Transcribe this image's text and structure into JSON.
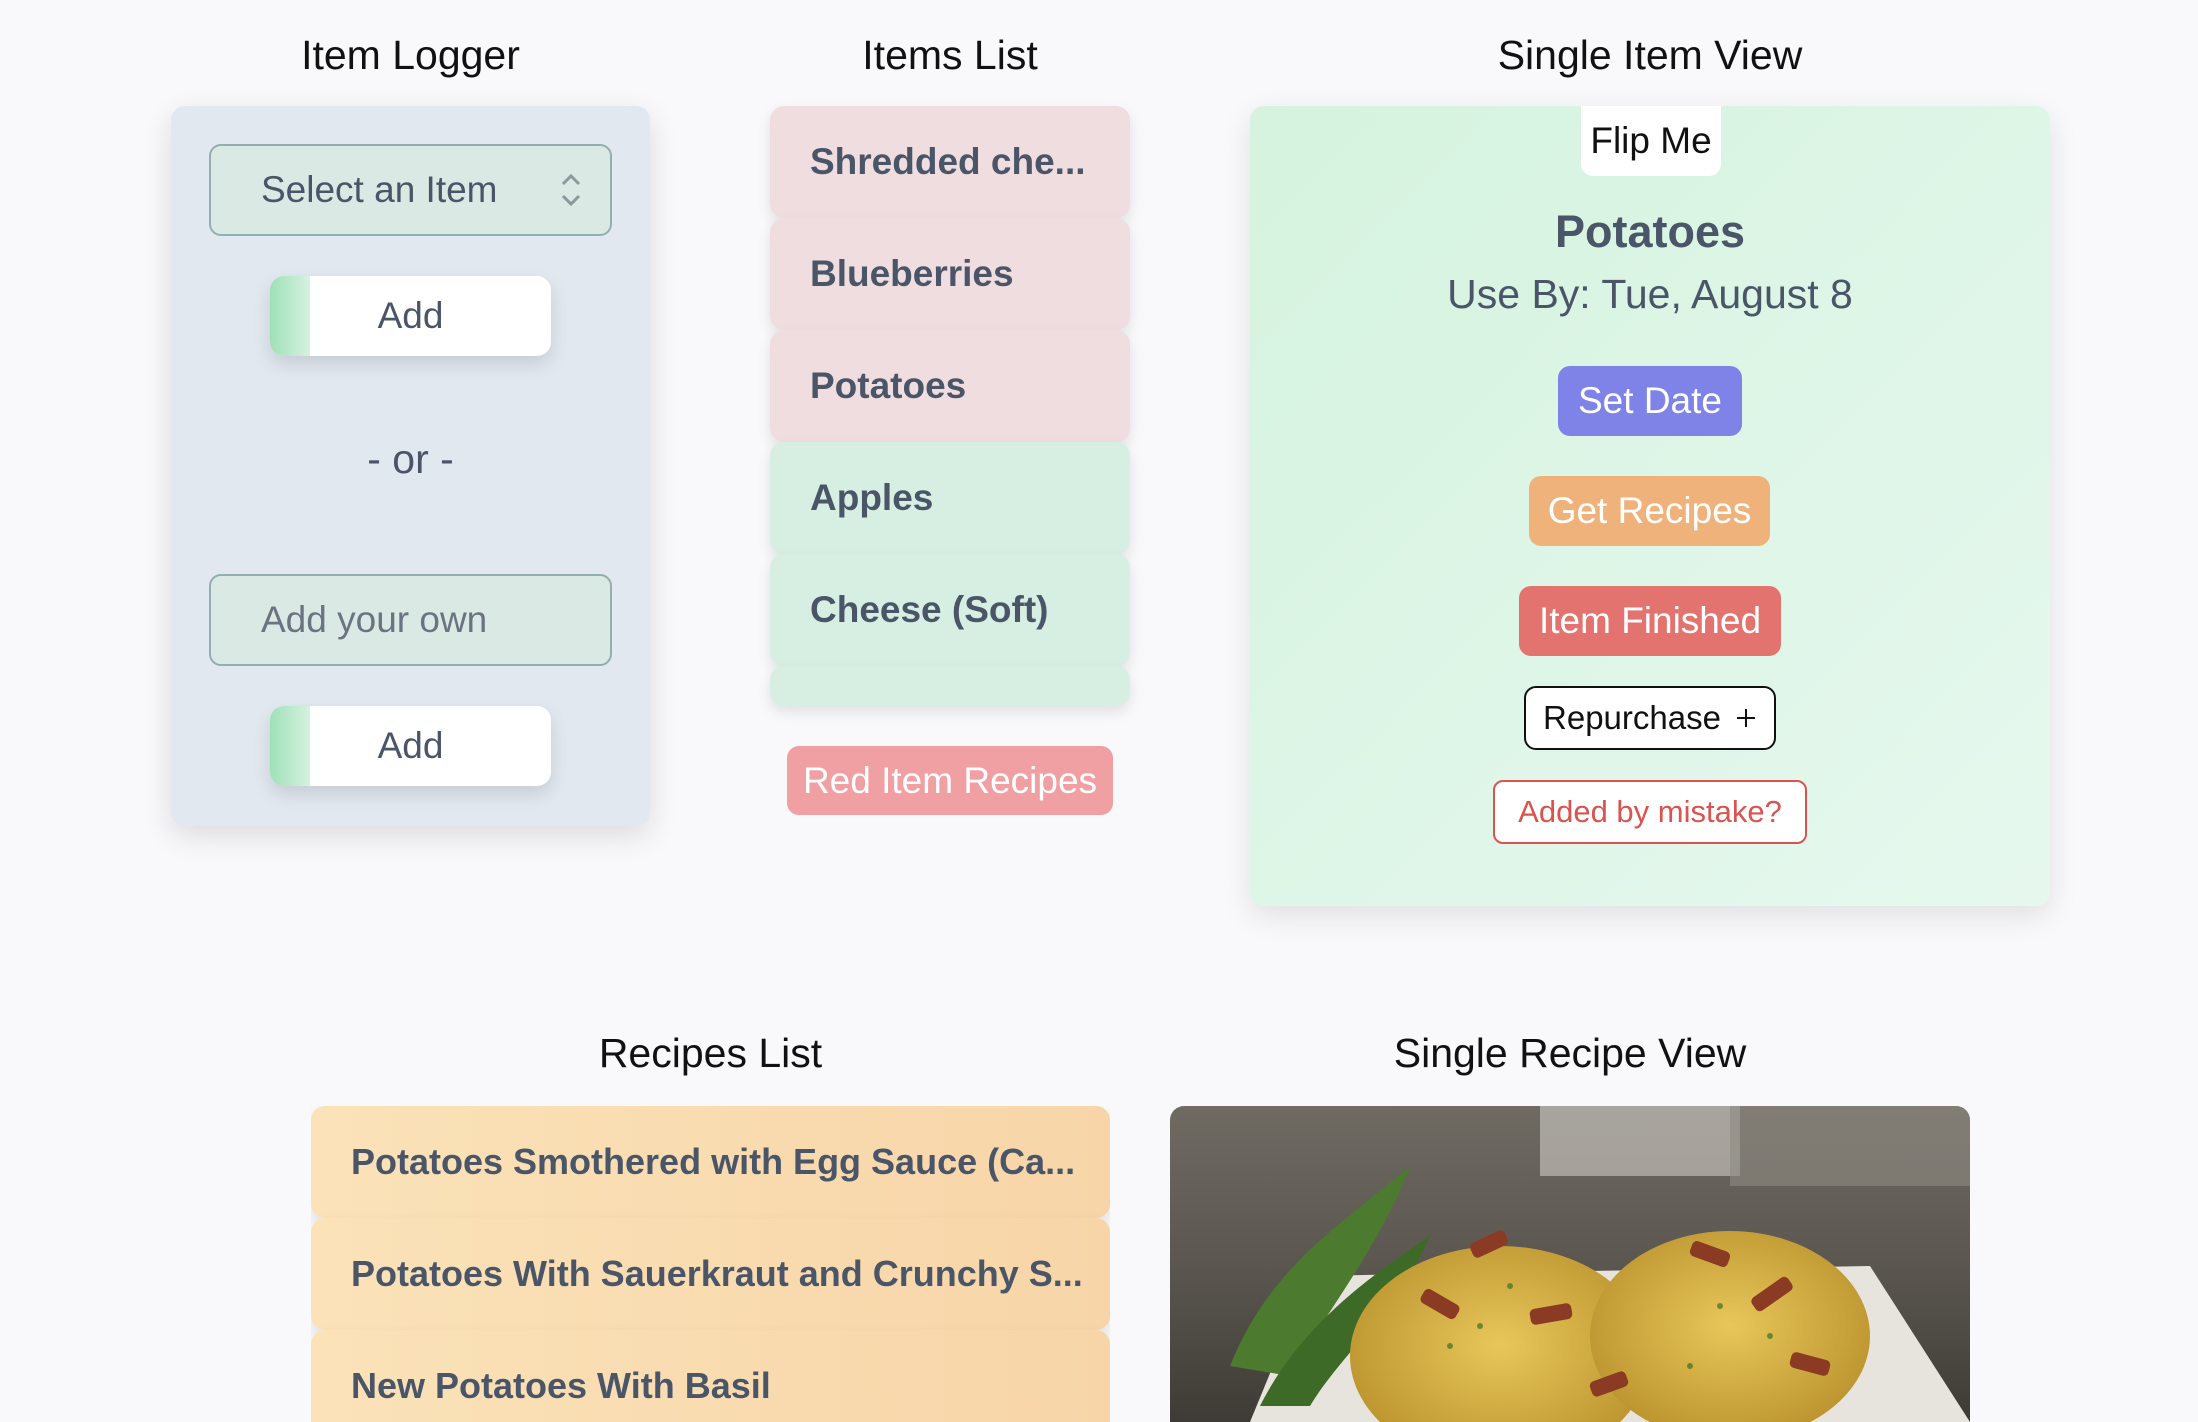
{
  "sections": {
    "item_logger": "Item Logger",
    "items_list": "Items List",
    "single_item_view": "Single Item View",
    "recipes_list": "Recipes List",
    "single_recipe_view": "Single Recipe View"
  },
  "logger": {
    "select_placeholder": "Select an Item",
    "add_label_1": "Add",
    "or_text": "- or -",
    "own_placeholder": "Add your own",
    "add_label_2": "Add"
  },
  "items": [
    {
      "label": "Shredded che...",
      "status": "red"
    },
    {
      "label": "Blueberries",
      "status": "red"
    },
    {
      "label": "Potatoes",
      "status": "red"
    },
    {
      "label": "Apples",
      "status": "green"
    },
    {
      "label": "Cheese (Soft)",
      "status": "green"
    }
  ],
  "red_item_recipes_label": "Red Item Recipes",
  "single_item": {
    "flip_label": "Flip Me",
    "name": "Potatoes",
    "use_by": "Use By: Tue, August 8",
    "set_date_label": "Set Date",
    "get_recipes_label": "Get Recipes",
    "item_finished_label": "Item Finished",
    "repurchase_label": "Repurchase",
    "mistake_label": "Added by mistake?"
  },
  "recipes": [
    "Potatoes Smothered with Egg Sauce (Ca...",
    "Potatoes With Sauerkraut and Crunchy S...",
    "New Potatoes With Basil"
  ],
  "colors": {
    "red_item": "#f0dde0",
    "green_item": "#d6efe2",
    "set_date": "#7f83e8",
    "get_recipes": "#efb27a",
    "item_finished": "#e2736f",
    "red_recipes": "#f0a0a3"
  }
}
